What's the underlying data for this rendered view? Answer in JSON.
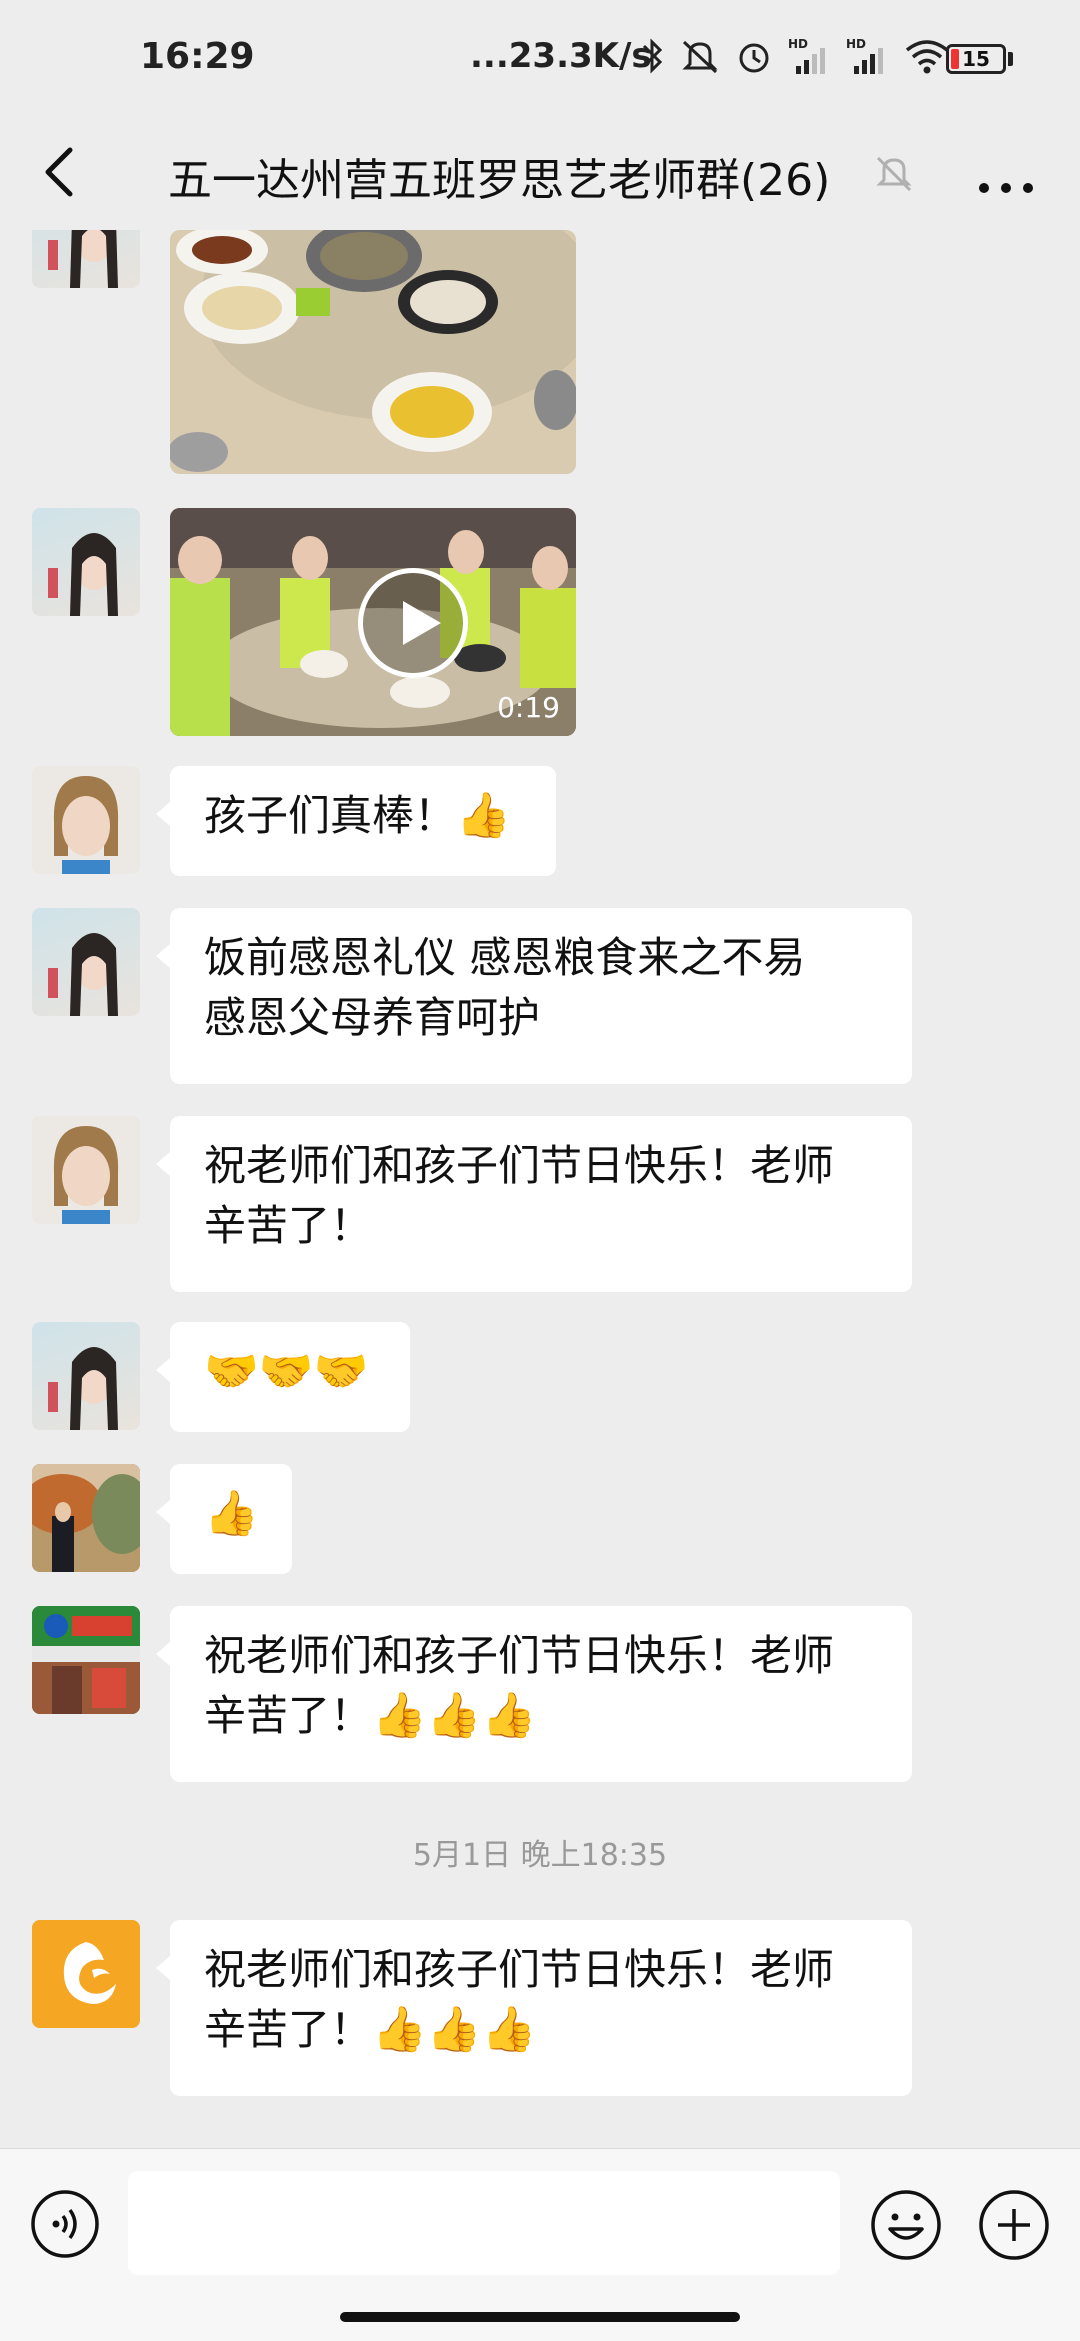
{
  "status_bar": {
    "time": "16:29",
    "net_speed": "...23.3K/s",
    "battery": "15",
    "battery_level_percent": 15,
    "icons": [
      "bluetooth-icon",
      "mute-icon",
      "alarm-icon",
      "signal-hd-icon",
      "signal-hd-icon",
      "wifi-icon",
      "battery-icon"
    ]
  },
  "header": {
    "title": "五一达州营五班罗思艺老师群(26)",
    "icons": [
      "back-icon",
      "mute-bell-icon",
      "more-icon"
    ]
  },
  "messages": [
    {
      "type": "image",
      "sender_avatar": "avatar-girl-photo",
      "duration": ""
    },
    {
      "type": "video",
      "sender_avatar": "avatar-girl-photo",
      "duration": "0:19"
    },
    {
      "type": "text",
      "sender_avatar": "avatar-woman-selfie",
      "text": "孩子们真棒！",
      "emoji": "👍"
    },
    {
      "type": "text",
      "sender_avatar": "avatar-girl-photo",
      "line1": "饭前感恩礼仪  感恩粮食来之不易",
      "line2": "感恩父母养育呵护"
    },
    {
      "type": "text",
      "sender_avatar": "avatar-woman-selfie",
      "line1": "祝老师们和孩子们节日快乐！老师",
      "line2": "辛苦了！"
    },
    {
      "type": "text",
      "sender_avatar": "avatar-girl-photo",
      "emoji": "🤝🤝🤝"
    },
    {
      "type": "text",
      "sender_avatar": "avatar-man-outdoor",
      "emoji": "👍"
    },
    {
      "type": "text",
      "sender_avatar": "avatar-telecom-store",
      "line1": "祝老师们和孩子们节日快乐！老师",
      "line2": "辛苦了！",
      "emoji": "👍👍👍"
    },
    {
      "type": "text",
      "sender_avatar": "avatar-orange-logo",
      "line1": "祝老师们和孩子们节日快乐！老师",
      "line2": "辛苦了！",
      "emoji": "👍👍👍"
    }
  ],
  "timestamp": "5月1日 晚上18:35",
  "colors": {
    "background": "#ededed",
    "bubble": "#ffffff",
    "accent_orange": "#f5a623"
  }
}
